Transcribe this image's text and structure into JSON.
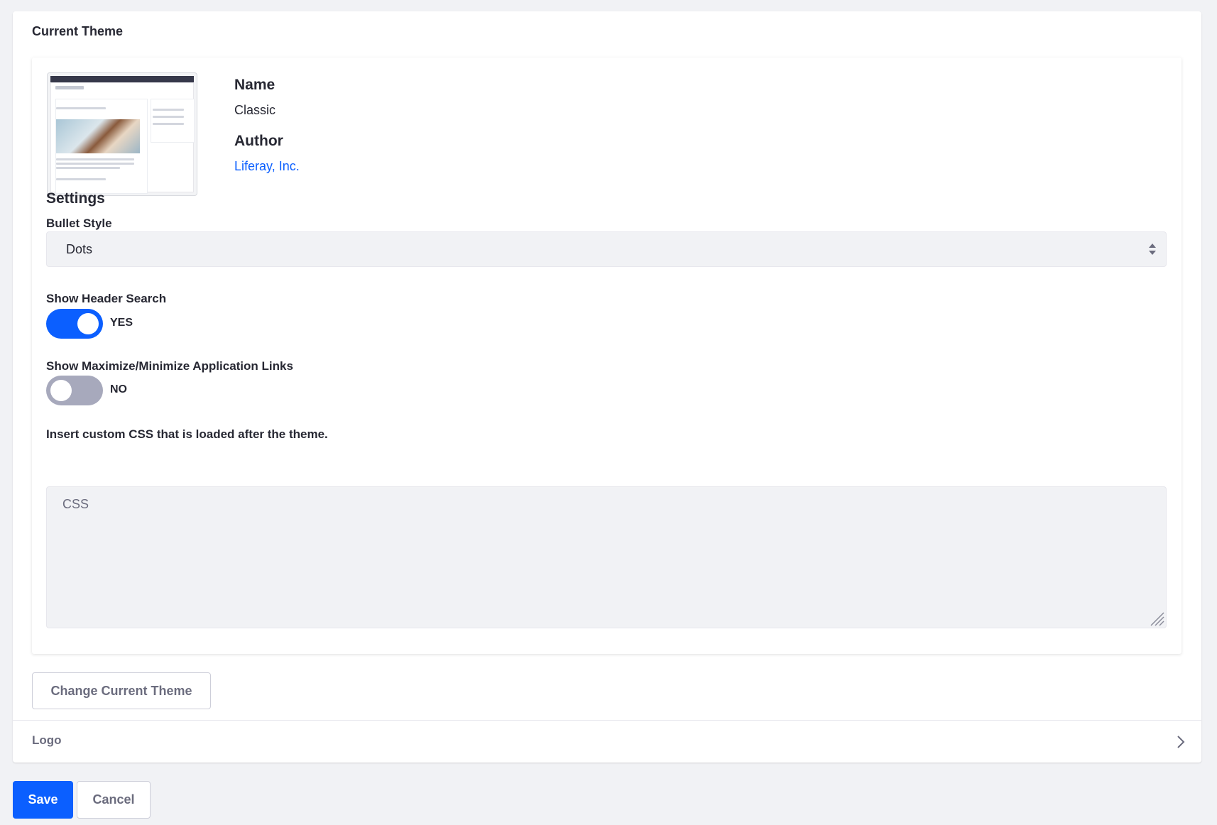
{
  "panel": {
    "title": "Current Theme"
  },
  "theme": {
    "name_label": "Name",
    "name_value": "Classic",
    "author_label": "Author",
    "author_value": "Liferay, Inc."
  },
  "settings": {
    "title": "Settings",
    "bullet_style": {
      "label": "Bullet Style",
      "value": "Dots"
    },
    "show_header_search": {
      "label": "Show Header Search",
      "state": "YES",
      "enabled": true
    },
    "show_maximize_minimize": {
      "label": "Show Maximize/Minimize Application Links",
      "state": "NO",
      "enabled": false
    },
    "custom_css": {
      "label": "Insert custom CSS that is loaded after the theme.",
      "placeholder": "CSS",
      "value": ""
    }
  },
  "actions": {
    "change_theme_label": "Change Current Theme",
    "logo_label": "Logo",
    "save_label": "Save",
    "cancel_label": "Cancel"
  },
  "colors": {
    "primary": "#0b5fff",
    "toggle_off": "#a7a9bc",
    "background": "#f1f2f5"
  }
}
